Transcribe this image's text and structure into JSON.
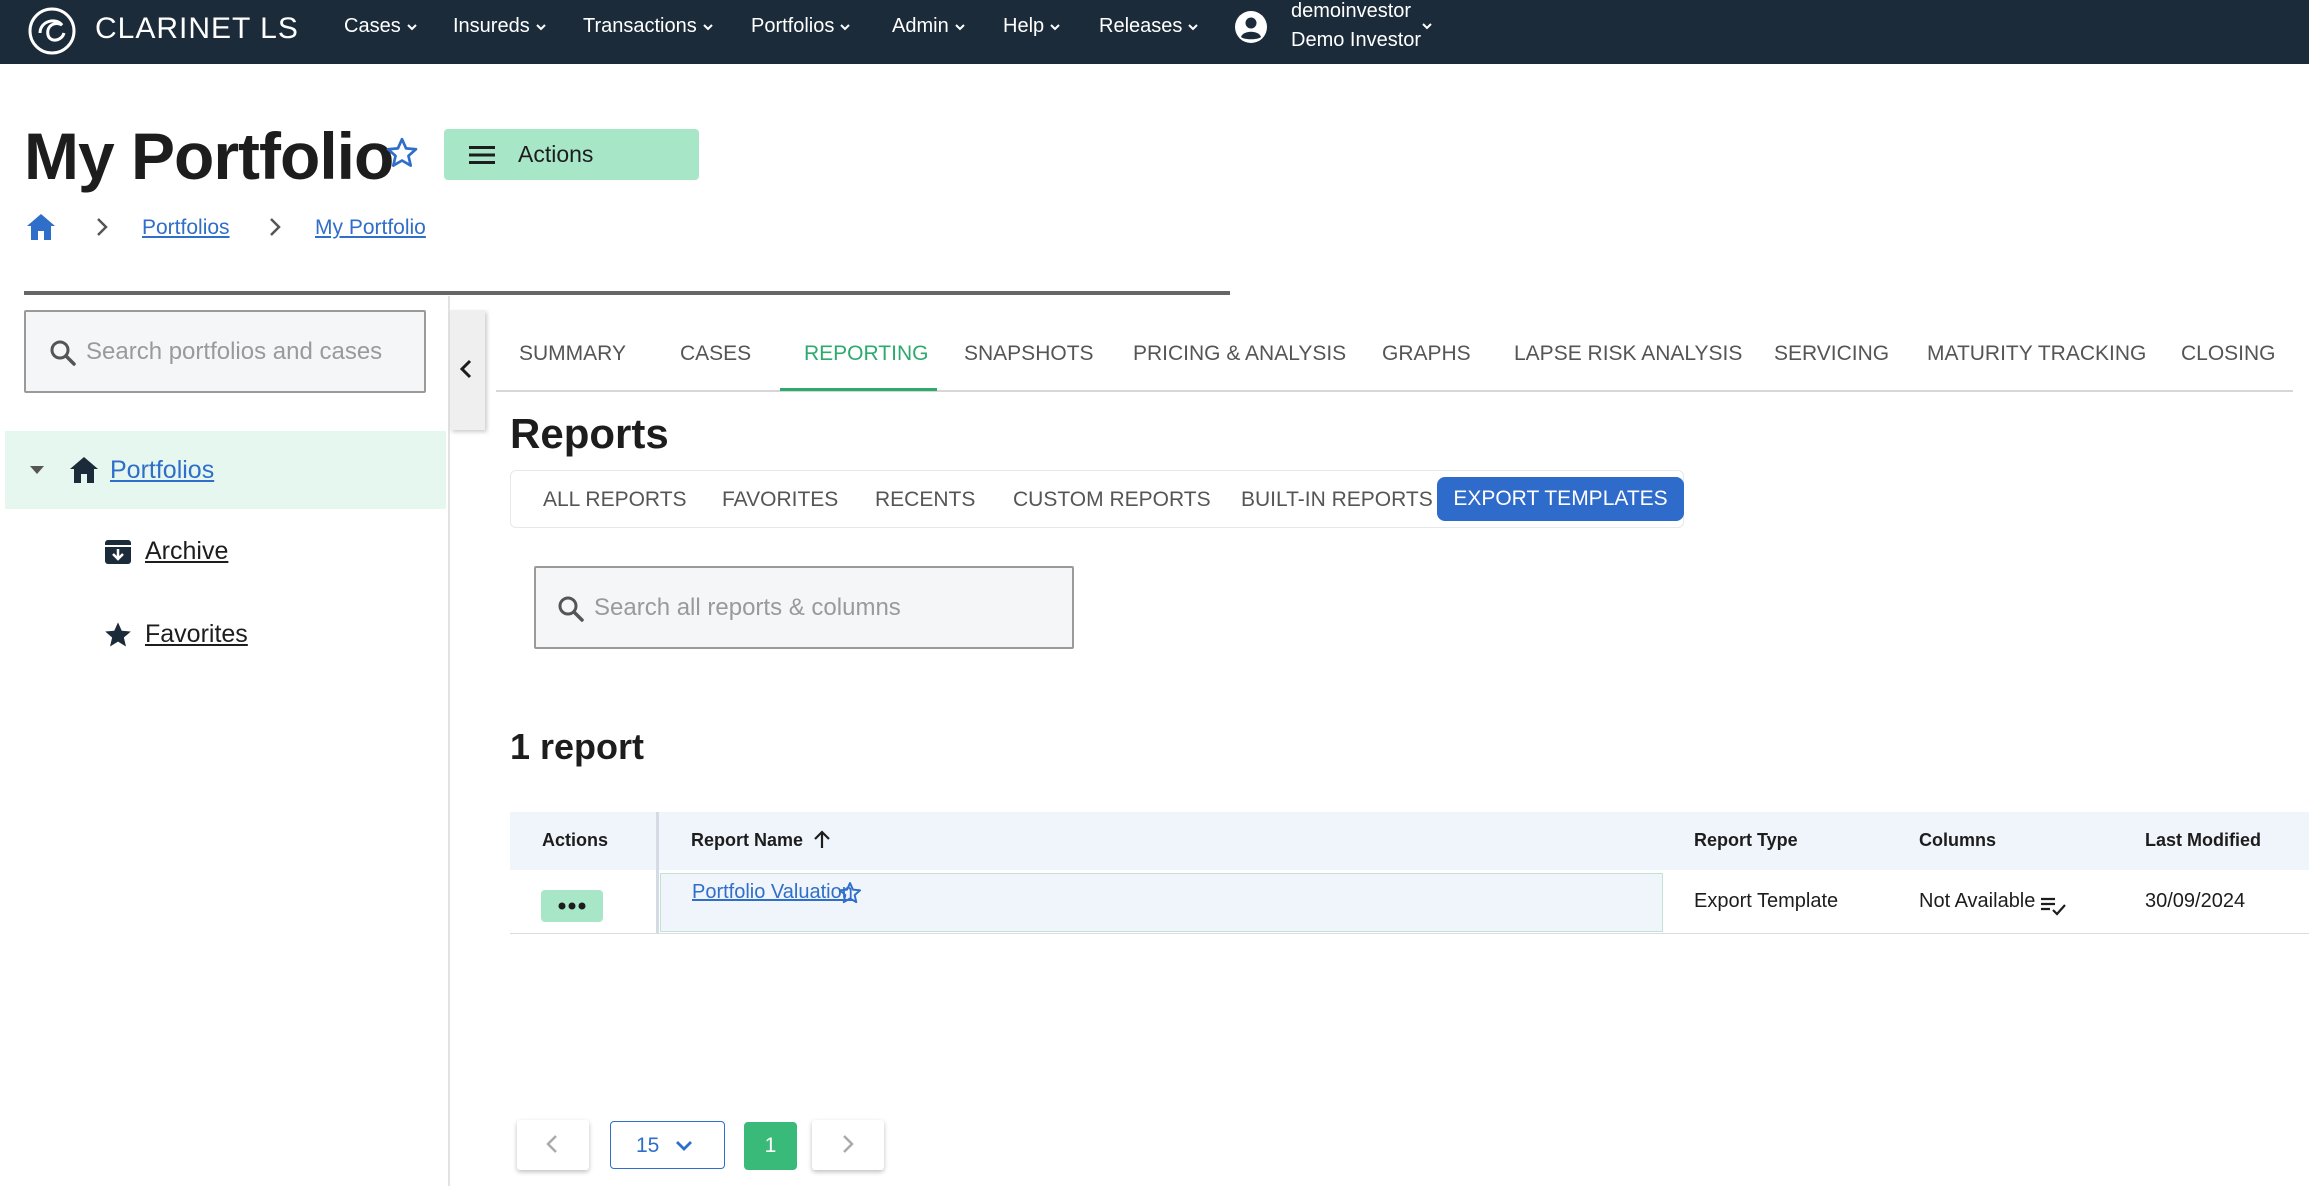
{
  "app": {
    "brand": "CLARINET LS",
    "colors": {
      "nav_bg": "#1c2b3a",
      "accent_green": "#2eaa6e",
      "primary_blue": "#2e6bcb",
      "action_green": "#a8e6c8"
    }
  },
  "nav": {
    "items": [
      "Cases",
      "Insureds",
      "Transactions",
      "Portfolios",
      "Admin",
      "Help",
      "Releases"
    ],
    "user": {
      "username": "demoinvestor",
      "display_name": "Demo Investor"
    }
  },
  "header": {
    "title": "My Portfolio",
    "actions_label": "Actions",
    "breadcrumb": [
      "Portfolios",
      "My Portfolio"
    ]
  },
  "sidebar": {
    "search_placeholder": "Search portfolios and cases",
    "root": "Portfolios",
    "children": [
      {
        "label": "Archive",
        "icon": "archive-icon"
      },
      {
        "label": "Favorites",
        "icon": "star-icon"
      }
    ]
  },
  "main_tabs": {
    "items": [
      "SUMMARY",
      "CASES",
      "REPORTING",
      "SNAPSHOTS",
      "PRICING & ANALYSIS",
      "GRAPHS",
      "LAPSE RISK ANALYSIS",
      "SERVICING",
      "MATURITY TRACKING",
      "CLOSING"
    ],
    "active": "REPORTING"
  },
  "reports": {
    "title": "Reports",
    "filters": [
      "ALL REPORTS",
      "FAVORITES",
      "RECENTS",
      "CUSTOM REPORTS",
      "BUILT-IN REPORTS",
      "EXPORT TEMPLATES"
    ],
    "active_filter": "EXPORT TEMPLATES",
    "search_placeholder": "Search all reports & columns",
    "count_label": "1 report",
    "columns": [
      "Actions",
      "Report Name",
      "Report Type",
      "Columns",
      "Last Modified"
    ],
    "sort": {
      "column": "Report Name",
      "direction": "ascending"
    },
    "rows": [
      {
        "name": "Portfolio Valuation",
        "type": "Export Template",
        "columns": "Not Available",
        "last_modified": "30/09/2024"
      }
    ]
  },
  "pagination": {
    "page_size": "15",
    "current_page": "1"
  }
}
